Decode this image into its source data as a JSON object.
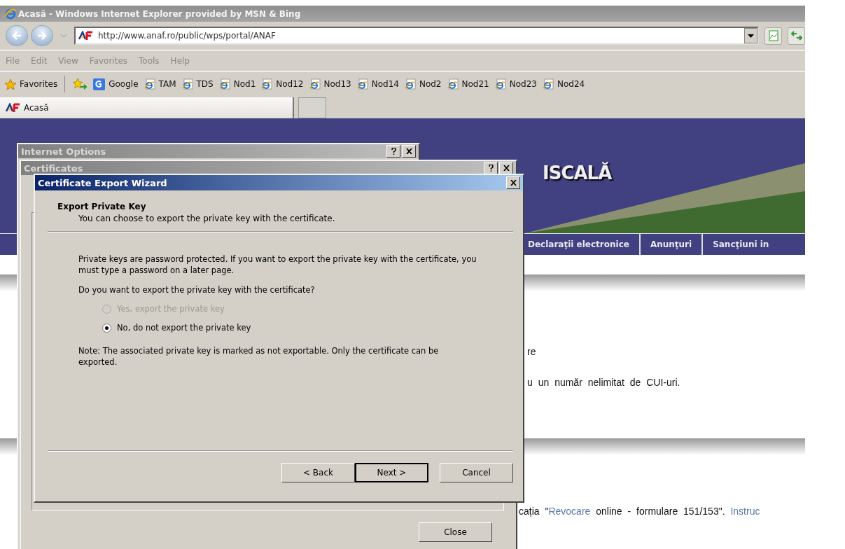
{
  "browser": {
    "title": "Acasă - Windows Internet Explorer provided by MSN & Bing",
    "address": "http://www.anaf.ro/public/wps/portal/ANAF",
    "menu": [
      "File",
      "Edit",
      "View",
      "Favorites",
      "Tools",
      "Help"
    ],
    "favorites_label": "Favorites",
    "favorites": [
      {
        "label": "Google",
        "kind": "google"
      },
      {
        "label": "TAM",
        "kind": "ie"
      },
      {
        "label": "TDS",
        "kind": "ie"
      },
      {
        "label": "Nod1",
        "kind": "ie"
      },
      {
        "label": "Nod12",
        "kind": "ie"
      },
      {
        "label": "Nod13",
        "kind": "ie"
      },
      {
        "label": "Nod14",
        "kind": "ie"
      },
      {
        "label": "Nod2",
        "kind": "ie"
      },
      {
        "label": "Nod21",
        "kind": "ie"
      },
      {
        "label": "Nod23",
        "kind": "ie"
      },
      {
        "label": "Nod24",
        "kind": "ie"
      }
    ],
    "tabs": [
      {
        "label": "Acasă",
        "selected": true
      }
    ]
  },
  "page": {
    "banner_title": "ISCALĂ",
    "nav": [
      "Declaraţii electronice",
      "Anunţuri",
      "Sancţiuni in"
    ],
    "lines": [
      [
        {
          "text": "re",
          "kind": "plain"
        }
      ],
      [
        {
          "text": "u un număr nelimitat de CUI-uri.",
          "kind": "plain"
        }
      ],
      [
        {
          "text": "cația \"",
          "kind": "plain"
        },
        {
          "text": "Revocare",
          "kind": "link"
        },
        {
          "text": " online - formulare 151/153\". ",
          "kind": "plain"
        },
        {
          "text": "Instruc",
          "kind": "link"
        }
      ]
    ]
  },
  "internet_options": {
    "title": "Internet Options"
  },
  "certificates": {
    "title": "Certificates",
    "close_button": "Close"
  },
  "wizard": {
    "title": "Certificate Export Wizard",
    "heading": "Export Private Key",
    "subheading": "You can choose to export the private key with the certificate.",
    "intro": "Private keys are password protected. If you want to export the private key with the certificate, you must type a password on a later page.",
    "question": "Do you want to export the private key with the certificate?",
    "options": [
      {
        "label": "Yes, export the private key",
        "selected": false,
        "disabled": true
      },
      {
        "label": "No, do not export the private key",
        "selected": true,
        "disabled": false
      }
    ],
    "note": "Note: The associated private key is marked as not exportable. Only the certificate can be exported.",
    "buttons": [
      {
        "label": "< Back",
        "default": false
      },
      {
        "label": "Next >",
        "default": true
      },
      {
        "label": "Cancel",
        "default": false
      }
    ]
  }
}
